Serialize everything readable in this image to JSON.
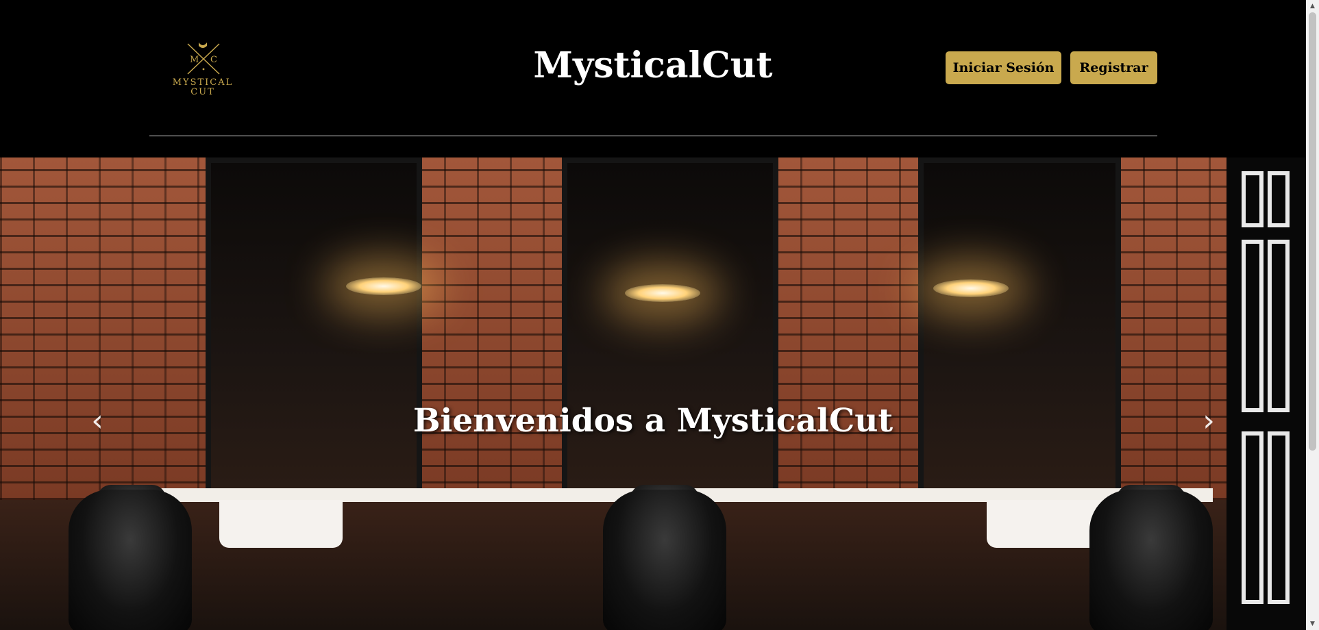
{
  "header": {
    "logo": {
      "initials_left": "M",
      "initials_right": "C",
      "text_line1": "MYSTICAL",
      "text_line2": "CUT"
    },
    "site_title": "MysticalCut",
    "login_label": "Iniciar Sesión",
    "register_label": "Registrar"
  },
  "carousel": {
    "caption": "Bienvenidos a MysticalCut",
    "prev_arrow": "‹",
    "next_arrow": "›"
  },
  "scrollbar": {
    "up": "▲",
    "down": "▼"
  },
  "colors": {
    "background": "#000000",
    "accent": "#c9a94e",
    "title": "#ffffff",
    "divider": "#d9d9d9"
  },
  "icons": [
    "crossed-razors-icon",
    "chevron-left-icon",
    "chevron-right-icon"
  ]
}
